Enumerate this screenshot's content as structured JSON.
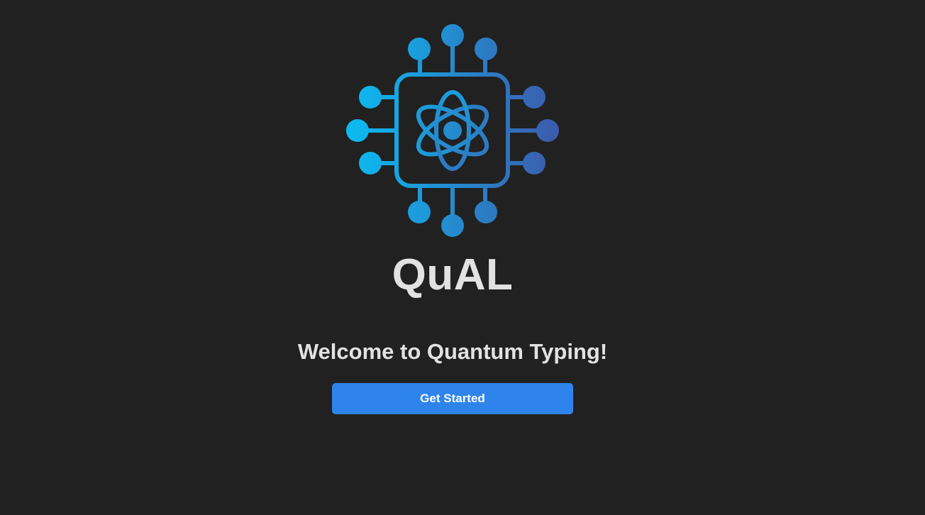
{
  "app": {
    "name": "QuAL",
    "logo_icon": "quantum-chip-atom-icon"
  },
  "welcome": {
    "heading": "Welcome to Quantum Typing!"
  },
  "actions": {
    "get_started_label": "Get Started"
  },
  "colors": {
    "background": "#212121",
    "text": "#e2e2e2",
    "button": "#2f84ec",
    "logo_gradient_start": "#0bbcf2",
    "logo_gradient_end": "#3d5aab"
  }
}
